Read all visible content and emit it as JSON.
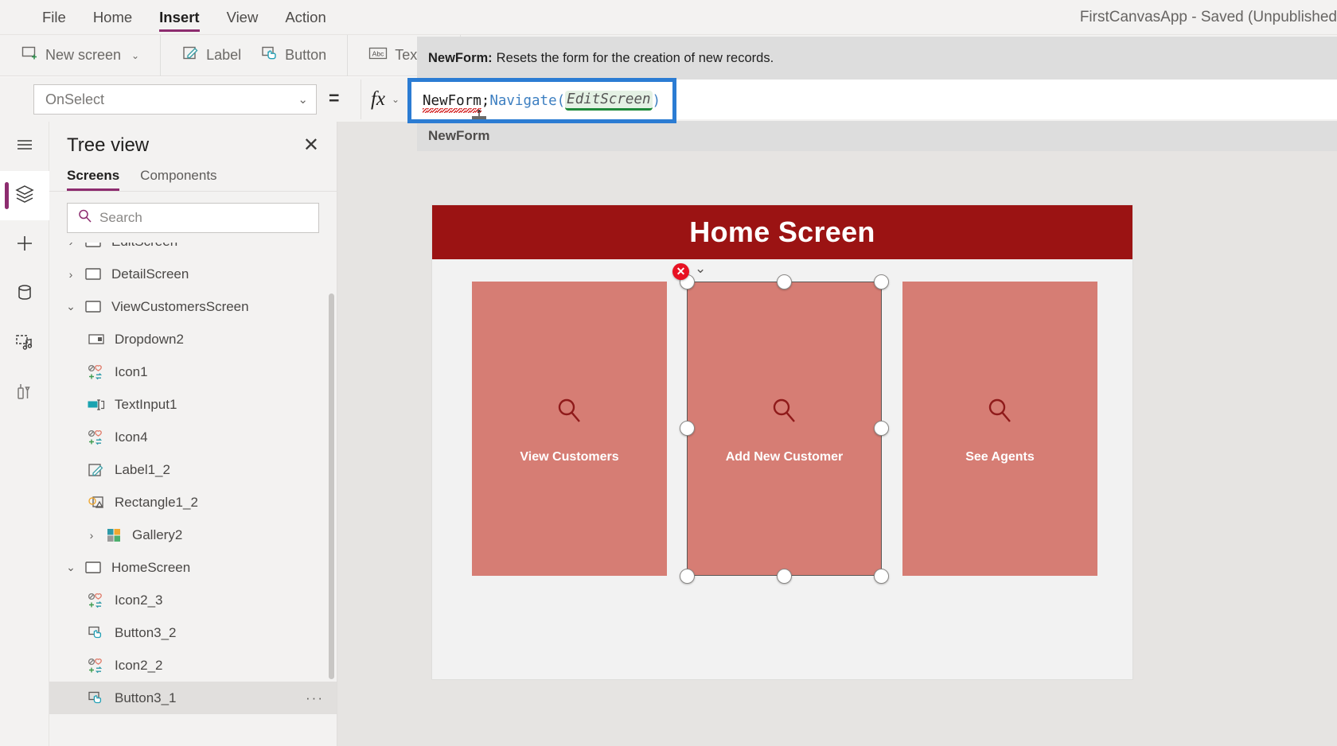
{
  "titlebar": {
    "menu": [
      {
        "label": "File",
        "active": false
      },
      {
        "label": "Home",
        "active": false
      },
      {
        "label": "Insert",
        "active": true
      },
      {
        "label": "View",
        "active": false
      },
      {
        "label": "Action",
        "active": false
      }
    ],
    "app_title": "FirstCanvasApp - Saved (Unpublished"
  },
  "ribbon": {
    "new_screen": "New screen",
    "label_btn": "Label",
    "button_btn": "Button",
    "text_btn": "Text",
    "chevron": "⌄"
  },
  "tooltip": {
    "fn_name": "NewForm:",
    "description": "Resets the form for the creation of new records."
  },
  "formula": {
    "property": "OnSelect",
    "equals": "=",
    "fx": "fx",
    "tokens": {
      "t1": "NewForm",
      "t2": ";",
      "t3": "Navigate",
      "t4": "(",
      "t5": "EditScreen",
      "t6": ")"
    },
    "full_text": "NewForm;Navigate(EditScreen)",
    "suggestion": "NewForm"
  },
  "rail": {
    "items": [
      {
        "name": "hamburger-menu-icon",
        "selected": false
      },
      {
        "name": "tree-view-layers-icon",
        "selected": true
      },
      {
        "name": "insert-plus-icon",
        "selected": false
      },
      {
        "name": "data-sources-icon",
        "selected": false
      },
      {
        "name": "media-icon",
        "selected": false
      },
      {
        "name": "advanced-tools-icon",
        "selected": false
      }
    ]
  },
  "treeview": {
    "title": "Tree view",
    "close": "✕",
    "tabs": [
      {
        "label": "Screens",
        "active": true
      },
      {
        "label": "Components",
        "active": false
      }
    ],
    "search_placeholder": "Search",
    "items": [
      {
        "label": "EditScreen",
        "indent": 0,
        "twisty": "›",
        "icon": "screen-icon",
        "selected": false,
        "clipped": true
      },
      {
        "label": "DetailScreen",
        "indent": 0,
        "twisty": "›",
        "icon": "screen-icon",
        "selected": false
      },
      {
        "label": "ViewCustomersScreen",
        "indent": 0,
        "twisty": "⌄",
        "icon": "screen-icon",
        "selected": false
      },
      {
        "label": "Dropdown2",
        "indent": 1,
        "twisty": "",
        "icon": "dropdown-icon",
        "selected": false
      },
      {
        "label": "Icon1",
        "indent": 1,
        "twisty": "",
        "icon": "icon-shape-icon",
        "selected": false
      },
      {
        "label": "TextInput1",
        "indent": 1,
        "twisty": "",
        "icon": "textinput-icon",
        "selected": false
      },
      {
        "label": "Icon4",
        "indent": 1,
        "twisty": "",
        "icon": "icon-shape-icon",
        "selected": false
      },
      {
        "label": "Label1_2",
        "indent": 1,
        "twisty": "",
        "icon": "label-icon",
        "selected": false
      },
      {
        "label": "Rectangle1_2",
        "indent": 1,
        "twisty": "",
        "icon": "shapes-icon",
        "selected": false
      },
      {
        "label": "Gallery2",
        "indent": 1,
        "twisty": "›",
        "icon": "gallery-icon",
        "selected": false
      },
      {
        "label": "HomeScreen",
        "indent": 0,
        "twisty": "⌄",
        "icon": "screen-icon",
        "selected": false
      },
      {
        "label": "Icon2_3",
        "indent": 1,
        "twisty": "",
        "icon": "icon-shape-icon",
        "selected": false
      },
      {
        "label": "Button3_2",
        "indent": 1,
        "twisty": "",
        "icon": "button-icon",
        "selected": false
      },
      {
        "label": "Icon2_2",
        "indent": 1,
        "twisty": "",
        "icon": "icon-shape-icon",
        "selected": false
      },
      {
        "label": "Button3_1",
        "indent": 1,
        "twisty": "",
        "icon": "button-icon",
        "selected": true,
        "dots": "···"
      }
    ]
  },
  "canvas": {
    "screen_title": "Home Screen",
    "header_color": "#9b1313",
    "card_color": "#d67d74",
    "icon_color": "#8f1a1a",
    "cards": [
      {
        "label": "View Customers",
        "icon": "magnifier-icon"
      },
      {
        "label": "Add New Customer",
        "icon": "magnifier-icon"
      },
      {
        "label": "See Agents",
        "icon": "magnifier-icon"
      }
    ],
    "selection": {
      "error_badge": "✕",
      "error_chevron": "⌄"
    }
  }
}
